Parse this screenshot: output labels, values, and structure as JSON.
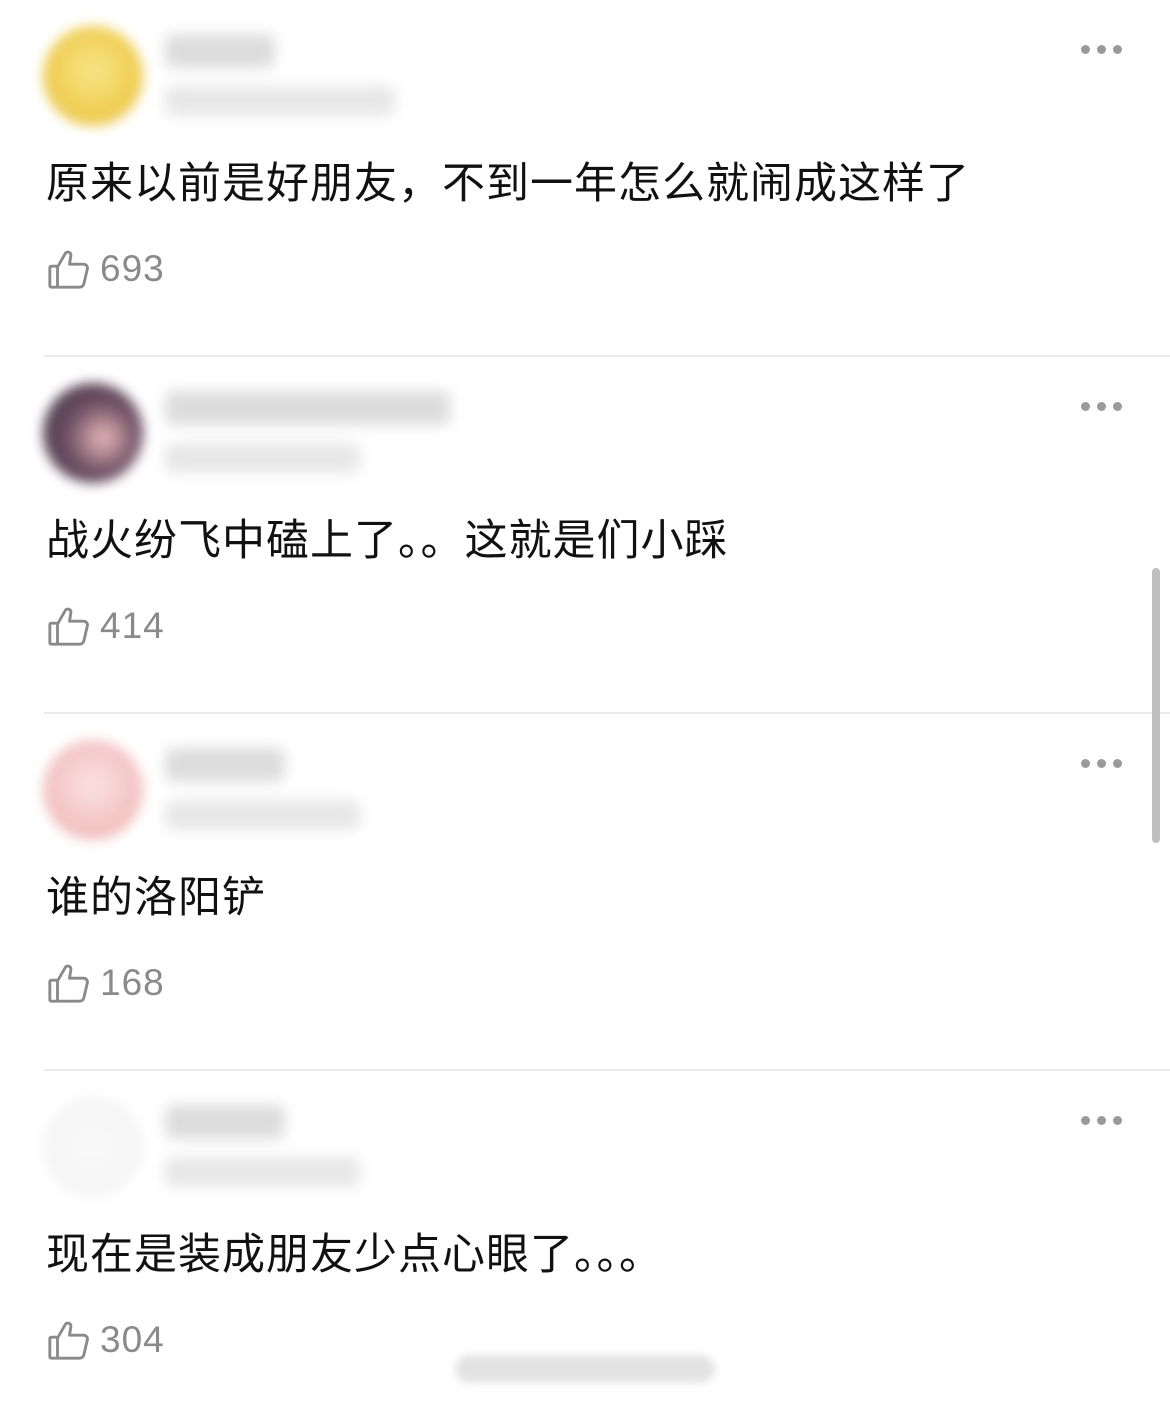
{
  "colors": {
    "text": "#111111",
    "muted": "#8a8a8a",
    "divider": "#ebebeb",
    "dots": "#9a9a9a"
  },
  "icons": {
    "like": "thumbs-up-icon",
    "more": "more-dots-icon"
  },
  "comments": [
    {
      "text": "原来以前是好朋友，不到一年怎么就闹成这样了",
      "likes": "693",
      "avatar_color": "#f2d86a"
    },
    {
      "text": "战火纷飞中磕上了。。这就是们小踩",
      "likes": "414",
      "avatar_color": "#5a4a5a"
    },
    {
      "text": "谁的洛阳铲",
      "likes": "168",
      "avatar_color": "#f3c2c2"
    },
    {
      "text": "现在是装成朋友少点心眼了。。。",
      "likes": "304",
      "avatar_color": "#f7f7f7"
    }
  ]
}
